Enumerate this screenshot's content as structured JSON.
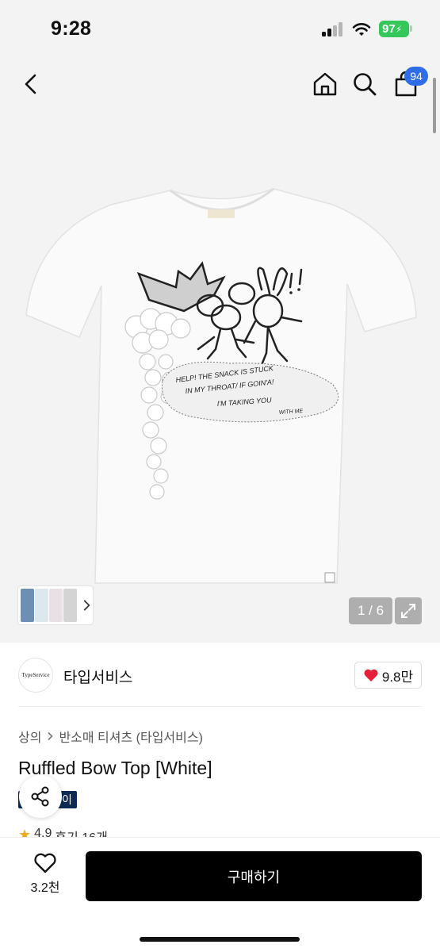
{
  "status_bar": {
    "time": "9:28",
    "battery": "97"
  },
  "header": {
    "cart_count": "94"
  },
  "gallery": {
    "page_counter": "1 / 6",
    "shirt_print": {
      "speech_line1": "HELP! THE SNACK IS STUCK",
      "speech_line2": "IN MY THROAT/ IF GOIN'A!",
      "speech_line3": "I'M TAKING YOU",
      "speech_line4": "WITH ME"
    }
  },
  "brand": {
    "logo_text": "TypeService",
    "name": "타입서비스",
    "likes": "9.8만"
  },
  "breadcrumb": [
    "상의",
    "반소매 티셔츠 (타입서비스)"
  ],
  "product": {
    "title": "Ruffled Bow Top [White]",
    "tag": "이",
    "rating": "4.9",
    "reviews": "후기 16개"
  },
  "bottom_bar": {
    "wish_count": "3.2천",
    "buy_label": "구매하기"
  },
  "colors": {
    "cart_badge": "#2f6de6",
    "heart": "#e5213a",
    "buy_button": "#000000",
    "tag": "#0b2a56",
    "star": "#f0a91f"
  }
}
